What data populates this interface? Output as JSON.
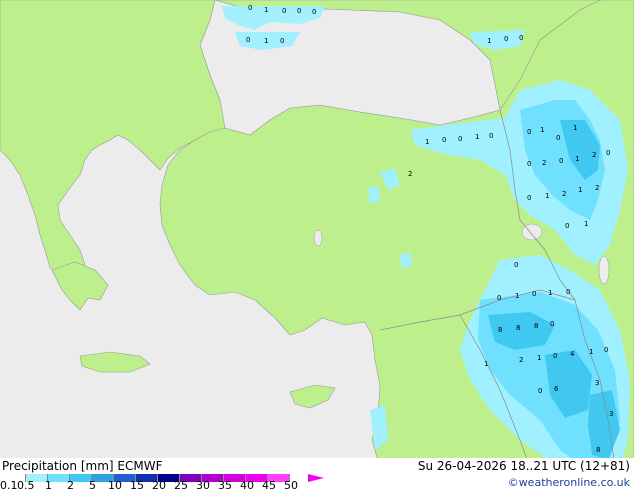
{
  "legend": {
    "title": "Precipitation [mm]",
    "model": "ECMWF",
    "levels": [
      "0.1",
      "0.5",
      "1",
      "2",
      "5",
      "10",
      "15",
      "20",
      "25",
      "30",
      "35",
      "40",
      "45",
      "50"
    ],
    "colors": [
      "#ffffff",
      "#a0f0ff",
      "#70e0ff",
      "#40c8f0",
      "#30a0e0",
      "#2060d0",
      "#1030b0",
      "#000090",
      "#8000c0",
      "#b000d0",
      "#d000e0",
      "#f000f0",
      "#ff40ff"
    ]
  },
  "timestamp": "Su 26-04-2026 18..21 UTC (12+81)",
  "credit": "©weatheronline.co.uk",
  "map": {
    "land_color": "#bdf08c",
    "sea_color": "#ececec",
    "precip_values": [
      "0",
      "1",
      "0",
      "0",
      "0",
      "0",
      "1",
      "0",
      "1",
      "0",
      "0",
      "1",
      "0",
      "0",
      "1",
      "0",
      "0",
      "1",
      "0",
      "1",
      "2",
      "0",
      "2",
      "0",
      "1",
      "2",
      "0",
      "1",
      "2",
      "1",
      "0",
      "2",
      "0",
      "1",
      "0",
      "0",
      "1",
      "0",
      "1",
      "0",
      "8",
      "8",
      "8",
      "0",
      "1",
      "2",
      "1",
      "0",
      "4",
      "1",
      "0",
      "0",
      "6",
      "3",
      "3",
      "8"
    ]
  }
}
